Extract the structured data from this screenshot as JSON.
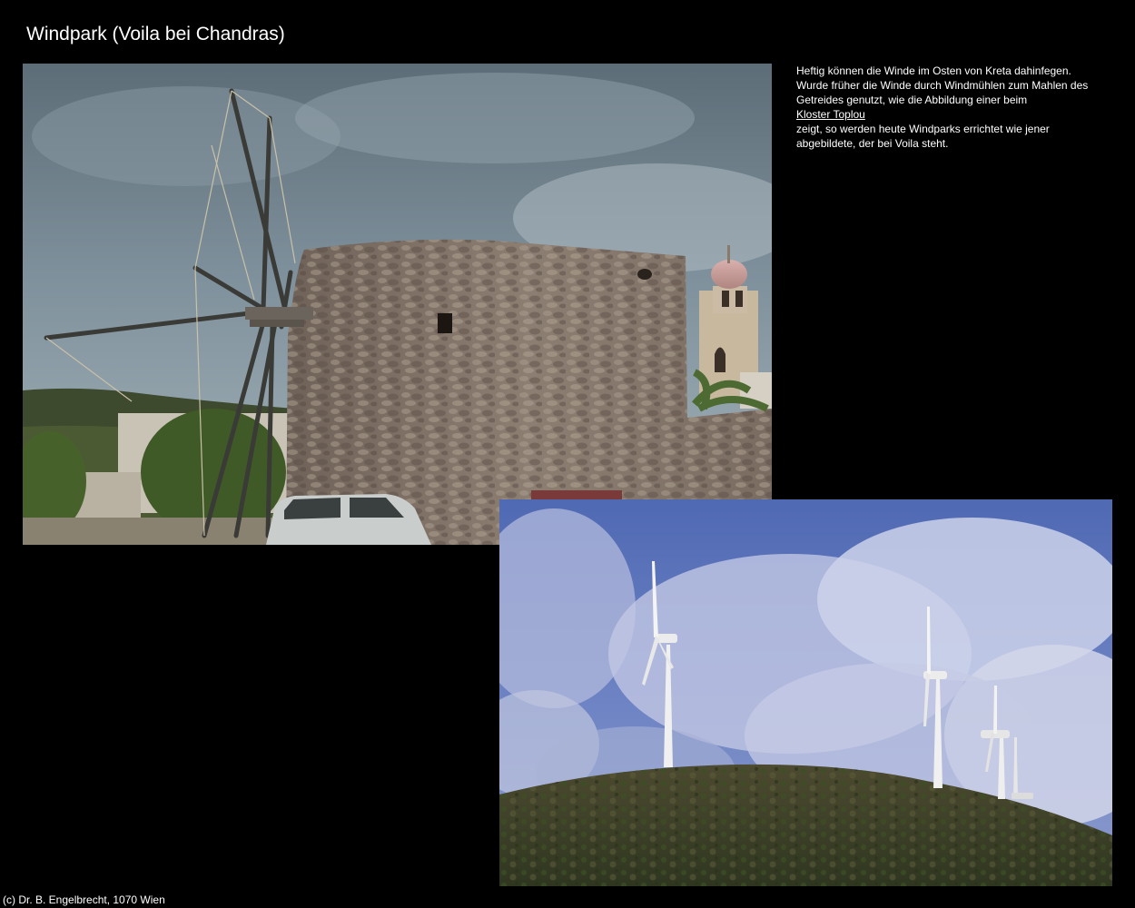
{
  "page": {
    "title": "Windpark (Voila bei Chandras)",
    "copyright": "(c) Dr. B. Engelbrecht, 1070 Wien"
  },
  "description": {
    "line1": "Heftig können die Winde im Osten von Kreta dahinfegen.",
    "line2": "Wurde früher die Winde durch Windmühlen zum Mahlen des",
    "line3": "Getreides genutzt, wie die Abbildung einer beim",
    "link_label": "Kloster Toplou",
    "line4": "zeigt, so werden heute Windparks errichtet wie jener",
    "line5": "abgebildete, der bei Voila steht."
  },
  "colors": {
    "background": "#000000",
    "text": "#ffffff"
  }
}
